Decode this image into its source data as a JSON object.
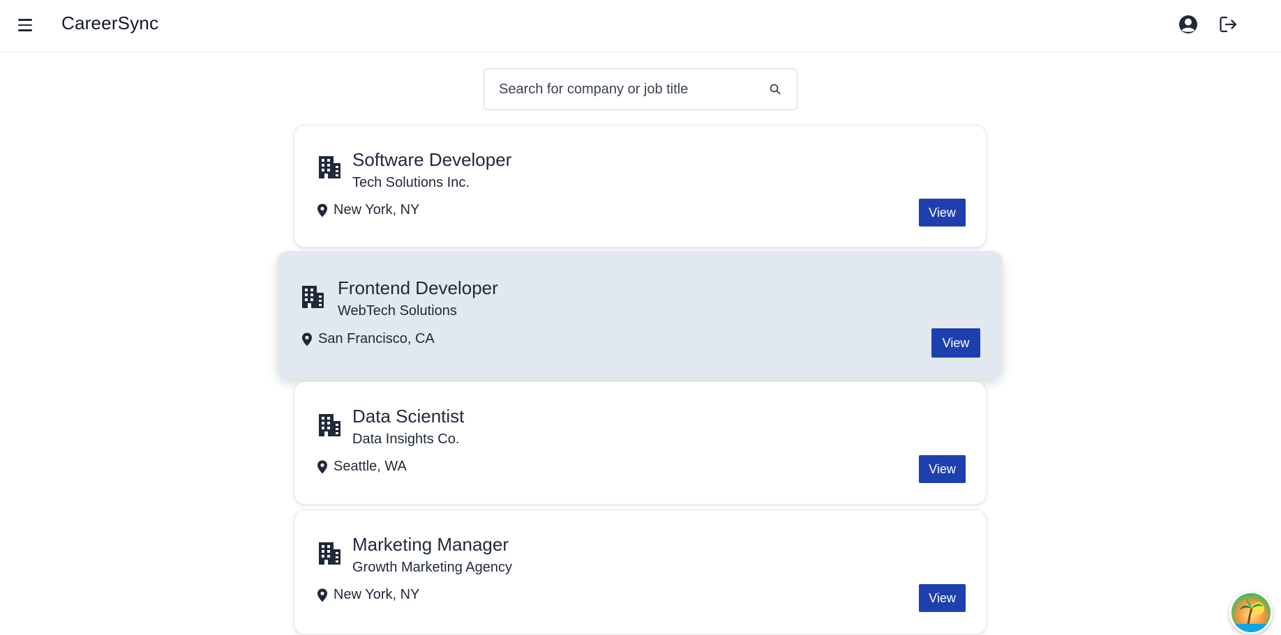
{
  "app": {
    "title": "CareerSync"
  },
  "search": {
    "placeholder": "Search for company or job title",
    "value": ""
  },
  "jobs": [
    {
      "title": "Software Developer",
      "company": "Tech Solutions Inc.",
      "location": "New York, NY",
      "button": "View"
    },
    {
      "title": "Frontend Developer",
      "company": "WebTech Solutions",
      "location": "San Francisco, CA",
      "button": "View"
    },
    {
      "title": "Data Scientist",
      "company": "Data Insights Co.",
      "location": "Seattle, WA",
      "button": "View"
    },
    {
      "title": "Marketing Manager",
      "company": "Growth Marketing Agency",
      "location": "New York, NY",
      "button": "View"
    }
  ],
  "icons": {
    "menu": "hamburger-icon",
    "profile": "user-circle-icon",
    "logout": "logout-icon",
    "search": "search-icon",
    "building": "building-icon",
    "location": "map-pin-icon"
  },
  "colors": {
    "primary": "#1e40af",
    "active_card": "#e2e8f0",
    "text": "#1f2937"
  }
}
